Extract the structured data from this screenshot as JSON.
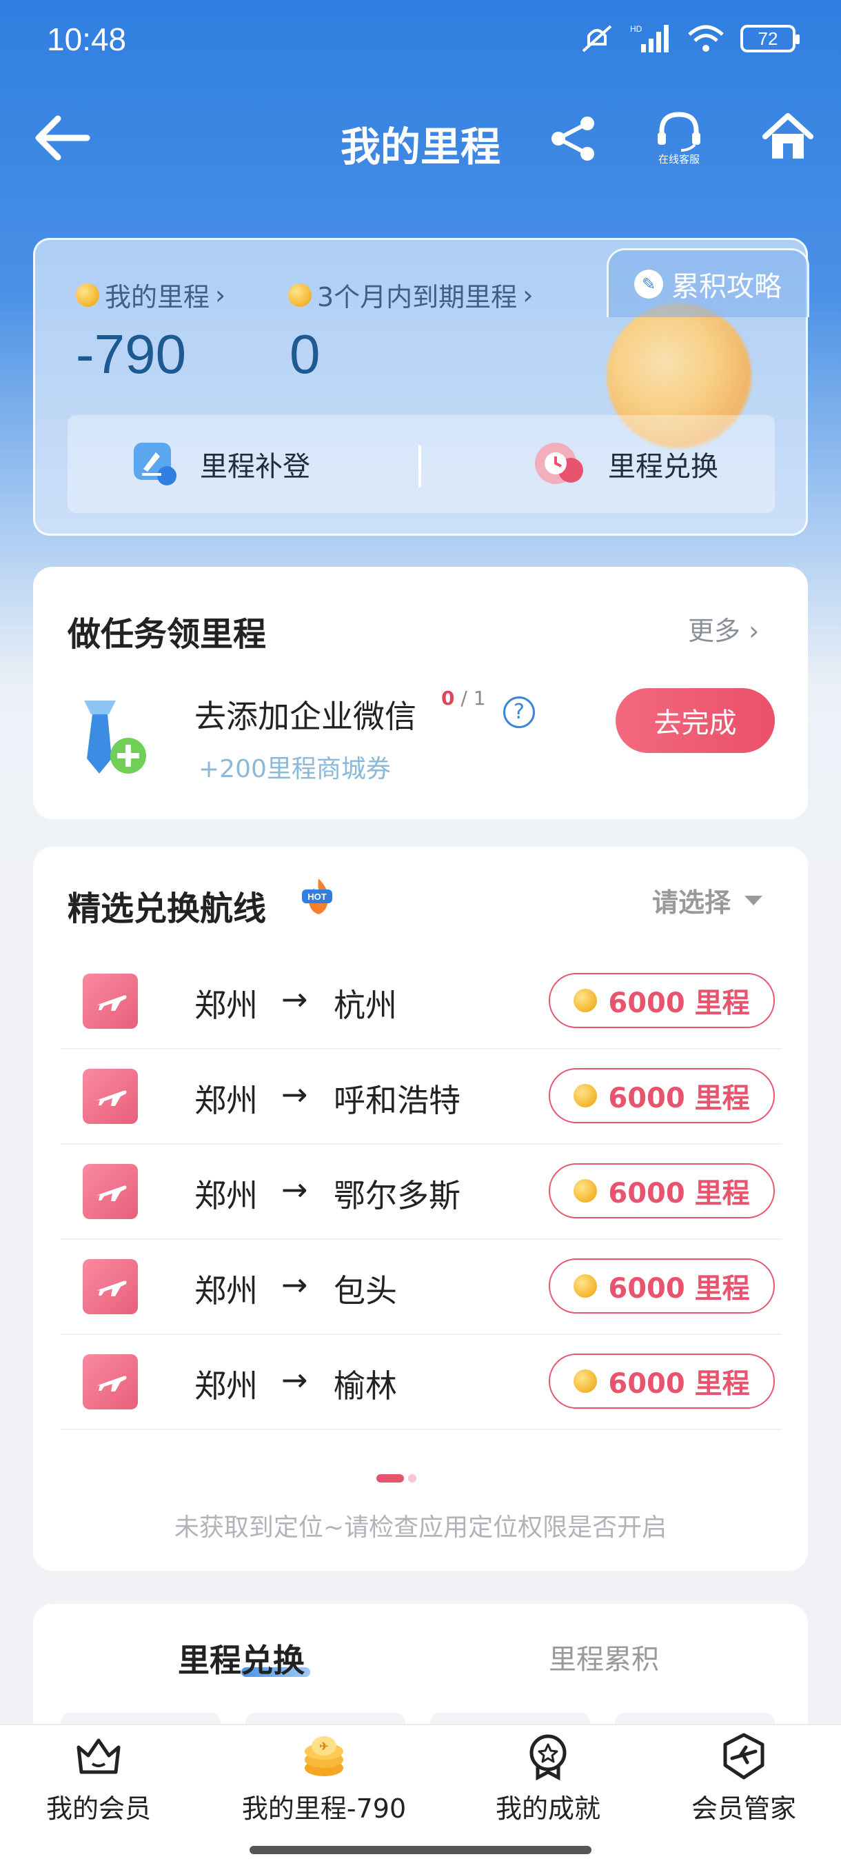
{
  "status_bar": {
    "time": "10:48",
    "battery": "72",
    "network": "HD"
  },
  "header": {
    "title": "我的里程",
    "service_label": "在线客服"
  },
  "mileage_card": {
    "strategy_label": "累积攻略",
    "my_miles_label": "我的里程",
    "my_miles_value": "-790",
    "expiring_label": "3个月内到期里程",
    "expiring_value": "0",
    "actions": [
      {
        "label": "里程补登"
      },
      {
        "label": "里程兑换"
      }
    ]
  },
  "tasks": {
    "title": "做任务领里程",
    "more_label": "更多",
    "item": {
      "name": "去添加企业微信",
      "progress_done": "0",
      "progress_total": "/ 1",
      "reward": "+200里程商城券",
      "button_label": "去完成"
    }
  },
  "routes": {
    "title": "精选兑换航线",
    "hot_badge": "HOT",
    "select_label": "请选择",
    "arrow": "→",
    "items": [
      {
        "from": "郑州",
        "to": "杭州",
        "price": "6000 里程"
      },
      {
        "from": "郑州",
        "to": "呼和浩特",
        "price": "6000 里程"
      },
      {
        "from": "郑州",
        "to": "鄂尔多斯",
        "price": "6000 里程"
      },
      {
        "from": "郑州",
        "to": "包头",
        "price": "6000 里程"
      },
      {
        "from": "郑州",
        "to": "榆林",
        "price": "6000 里程"
      }
    ],
    "location_note": "未获取到定位~请检查应用定位权限是否开启"
  },
  "exchange_tabs": {
    "active": "里程兑换",
    "inactive": "里程累积"
  },
  "bottom_nav": [
    {
      "label": "我的会员",
      "icon": "crown-icon"
    },
    {
      "label": "我的里程-790",
      "icon": "coin-stack-icon"
    },
    {
      "label": "我的成就",
      "icon": "medal-icon"
    },
    {
      "label": "会员管家",
      "icon": "plane-shield-icon"
    }
  ],
  "colors": {
    "primary": "#2f7ee0",
    "accent": "#e8536d",
    "coin": "#f3b52c"
  }
}
